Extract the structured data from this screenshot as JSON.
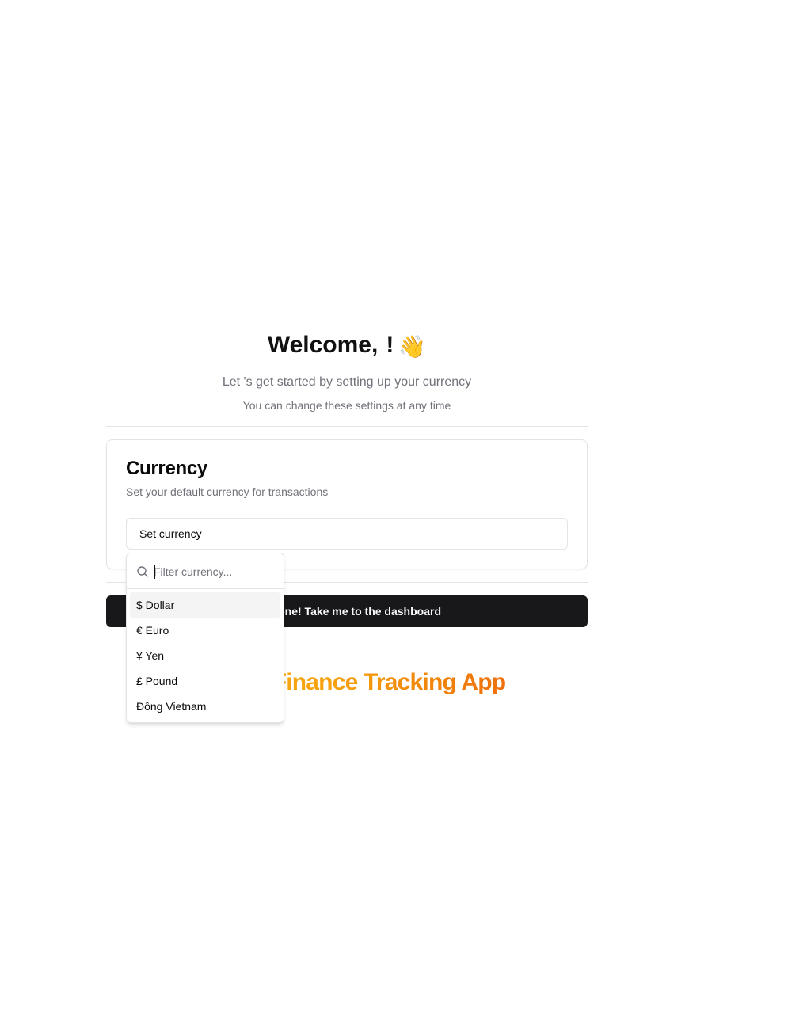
{
  "welcome": {
    "text": "Welcome,",
    "exclamation": "!",
    "emoji": "👋"
  },
  "subtitle": "Let 's get started by setting up your currency",
  "hint": "You can change these settings at any time",
  "currency_card": {
    "title": "Currency",
    "description": "Set your default currency for transactions",
    "button_label": "Set currency"
  },
  "dropdown": {
    "filter_placeholder": "Filter currency...",
    "options": [
      "$ Dollar",
      "€ Euro",
      "¥ Yen",
      "£ Pound",
      "Đồng Vietnam"
    ],
    "highlighted": "$ Dollar"
  },
  "cta_label": "I'm done! Take me to the dashboard",
  "brand": "Budget Finance Tracking App",
  "colors": {
    "cta_background": "#18181b",
    "brand_gradient_start": "#fbbf24",
    "brand_gradient_end": "#ea580c",
    "muted_text": "#71717a",
    "border": "#e4e4e7"
  }
}
